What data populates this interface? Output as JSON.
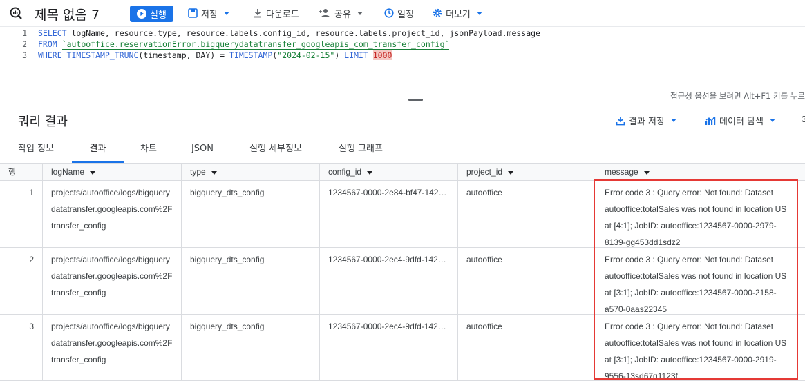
{
  "toolbar": {
    "title": "제목 없음 7",
    "run_label": "실행",
    "save_label": "저장",
    "download_label": "다운로드",
    "share_label": "공유",
    "schedule_label": "일정",
    "more_label": "더보기"
  },
  "editor": {
    "line_numbers": [
      "1",
      "2",
      "3"
    ],
    "line1_kw": "SELECT",
    "line1_rest": " logName, resource.type, resource.labels.config_id, resource.labels.project_id, jsonPayload.message",
    "line2_kw": "FROM",
    "line2_table": "`autooffice.reservationError.bigquerydatatransfer_googleapis_com_transfer_config`",
    "line3_kw1": "WHERE",
    "line3_fn1": " TIMESTAMP_TRUNC",
    "line3_mid": "(timestamp, DAY) = ",
    "line3_fn2": "TIMESTAMP",
    "line3_paren_open": "(",
    "line3_str": "\"2024-02-15\"",
    "line3_paren_close": ") ",
    "line3_kw2": "LIMIT",
    "line3_limit": "1000",
    "accessibility_hint": "접근성 옵션을 보려면 Alt+F1 키를 누르"
  },
  "results": {
    "title": "쿼리 결과",
    "save_results_label": "결과 저장",
    "explore_label": "데이터 탐색",
    "more_char": "3"
  },
  "tabs": [
    "작업 정보",
    "결과",
    "차트",
    "JSON",
    "실행 세부정보",
    "실행 그래프"
  ],
  "active_tab": "결과",
  "grid": {
    "row_header": "행",
    "columns": [
      "logName",
      "type",
      "config_id",
      "project_id",
      "message"
    ],
    "rows": [
      {
        "num": "1",
        "logName": "projects/autooffice/logs/bigquerydatatransfer.googleapis.com%2Ftransfer_config",
        "type": "bigquery_dts_config",
        "config_id": "1234567-0000-2e84-bf47-1422...",
        "project_id": "autooffice",
        "message": "Error code 3 : Query error: Not found: Dataset autooffice:totalSales was not found in location US at [4:1]; JobID: autooffice:1234567-0000-2979-8139-gg453dd1sdz2"
      },
      {
        "num": "2",
        "logName": "projects/autooffice/logs/bigquerydatatransfer.googleapis.com%2Ftransfer_config",
        "type": "bigquery_dts_config",
        "config_id": "1234567-0000-2ec4-9dfd-1422...",
        "project_id": "autooffice",
        "message": "Error code 3 : Query error: Not found: Dataset autooffice:totalSales was not found in location US at [3:1]; JobID: autooffice:1234567-0000-2158-a570-0aas22345"
      },
      {
        "num": "3",
        "logName": "projects/autooffice/logs/bigquerydatatransfer.googleapis.com%2Ftransfer_config",
        "type": "bigquery_dts_config",
        "config_id": "1234567-0000-2ec4-9dfd-1422...",
        "project_id": "autooffice",
        "message": "Error code 3 : Query error: Not found: Dataset autooffice:totalSales was not found in location US at [3:1]; JobID: autooffice:1234567-0000-2919-9556-13sd67g1123f"
      }
    ]
  },
  "colors": {
    "accent": "#1a73e8",
    "highlight_border": "#e53935",
    "keyword": "#3367d6",
    "string": "#188038"
  }
}
